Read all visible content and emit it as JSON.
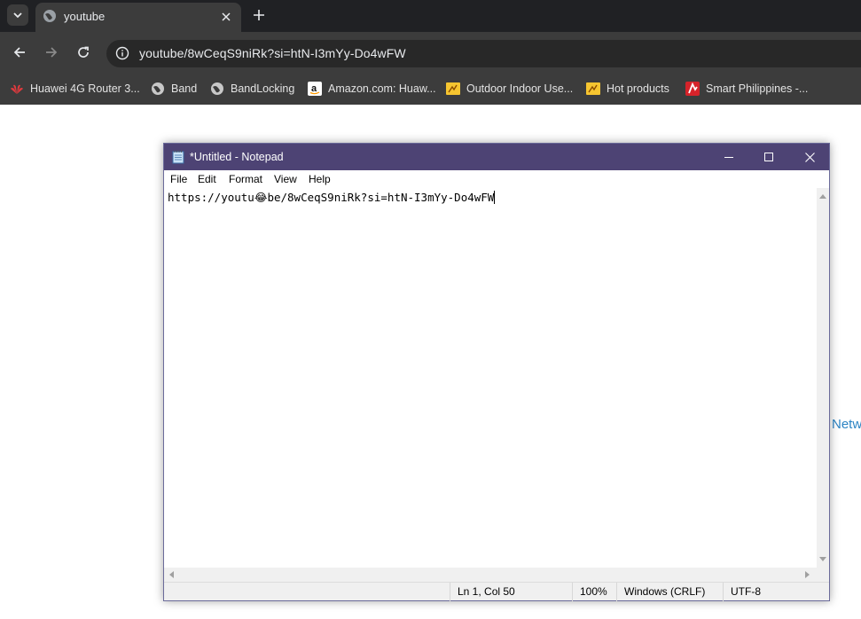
{
  "browser": {
    "tab": {
      "title": "youtube"
    },
    "address": {
      "url": "youtube/8wCeqS9niRk?si=htN-I3mYy-Do4wFW"
    },
    "bookmarks": [
      {
        "label": "Huawei 4G Router 3...",
        "icon": "huawei-icon"
      },
      {
        "label": "Band",
        "icon": "globe-icon"
      },
      {
        "label": "BandLocking",
        "icon": "globe-icon"
      },
      {
        "label": "Amazon.com: Huaw...",
        "icon": "amazon-icon"
      },
      {
        "label": "Outdoor Indoor Use...",
        "icon": "folder-icon"
      },
      {
        "label": "Hot products",
        "icon": "folder-icon"
      },
      {
        "label": "Smart Philippines -...",
        "icon": "smart-icon"
      }
    ]
  },
  "page": {
    "partial_link": "Netw"
  },
  "notepad": {
    "title": "*Untitled - Notepad",
    "menu": [
      "File",
      "Edit",
      "Format",
      "View",
      "Help"
    ],
    "content_before": "https://youtu",
    "content_emoji": "😂",
    "content_after": "be/8wCeqS9niRk?si=htN-I3mYy-Do4wFW",
    "status": {
      "position": "Ln 1, Col 50",
      "zoom": "100%",
      "line_ending": "Windows (CRLF)",
      "encoding": "UTF-8"
    }
  },
  "colors": {
    "tabstrip": "#202124",
    "toolbar": "#3c3c3c",
    "notepad_titlebar": "#4d4374",
    "link": "#2c84c4"
  }
}
